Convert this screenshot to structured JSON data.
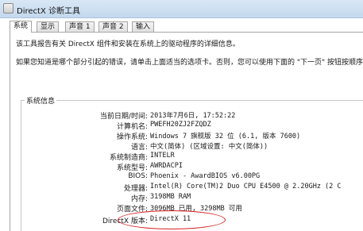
{
  "window": {
    "title": "DirectX 诊断工具"
  },
  "tabs": [
    {
      "label": "系统",
      "active": true
    },
    {
      "label": "显示",
      "active": false
    },
    {
      "label": "声音 1",
      "active": false
    },
    {
      "label": "声音 2",
      "active": false
    },
    {
      "label": "输入",
      "active": false
    }
  ],
  "intro": {
    "line1": "该工具报告有关 DirectX 组件和安装在系统上的驱动程序的详细信息。",
    "line2": "如果您知道是哪个部分引起的错误，请单击上面适当的选项卡。否则，您可以使用下面的 \"下一页\" 按钮按顺序"
  },
  "system_info": {
    "group_label": "系统信息",
    "rows": [
      {
        "key": "当前日期/时间:",
        "value": "2013年7月6日, 17:52:22"
      },
      {
        "key": "计算机名:",
        "value": "PWEFH20ZJ2FZQDZ"
      },
      {
        "key": "操作系统:",
        "value": "Windows 7 旗舰版 32 位 (6.1, 版本 7600)"
      },
      {
        "key": "语言:",
        "value": "中文(简体) (区域设置: 中文(简体))"
      },
      {
        "key": "系统制造商:",
        "value": "INTELR"
      },
      {
        "key": "系统型号:",
        "value": "AWRDACPI"
      },
      {
        "key": "BIOS:",
        "value": "Phoenix - AwardBIOS v6.00PG"
      },
      {
        "key": "处理器:",
        "value": "Intel(R) Core(TM)2 Duo CPU     E4500  @ 2.20GHz (2 C"
      },
      {
        "key": "内存:",
        "value": "3198MB RAM"
      },
      {
        "key": "页面文件:",
        "value": "3096MB 已用, 3298MB 可用"
      },
      {
        "key": "DirectX 版本:",
        "value": "DirectX 11"
      }
    ]
  },
  "highlight_color": "#d42020"
}
